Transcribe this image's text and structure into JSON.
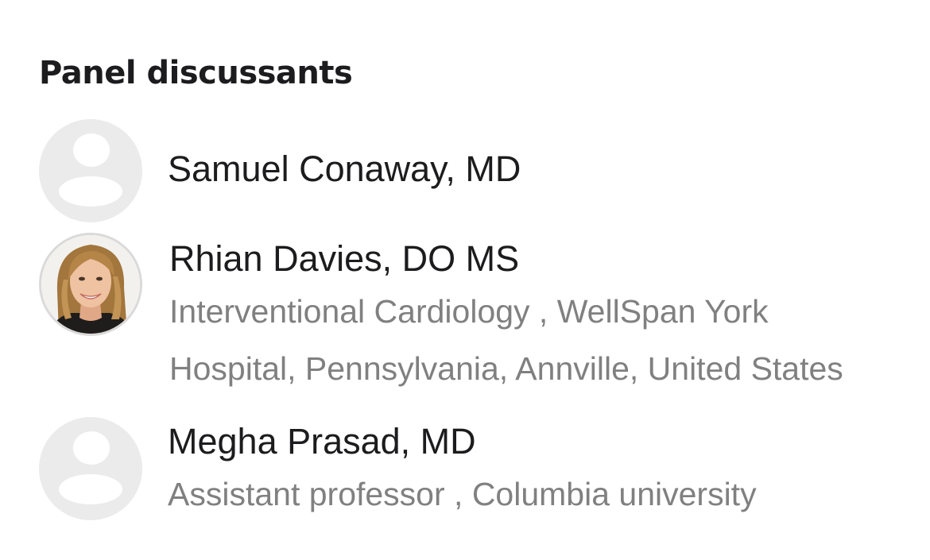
{
  "section": {
    "title": "Panel discussants"
  },
  "panelists": [
    {
      "name": "Samuel Conaway, MD",
      "affiliation": "",
      "avatar": "person-placeholder-icon"
    },
    {
      "name": "Rhian Davies, DO MS",
      "affiliation": "Interventional Cardiology , WellSpan York Hospital, Pennsylvania, Annville, United States",
      "avatar": "profile-photo"
    },
    {
      "name": "Megha Prasad, MD",
      "affiliation": "Assistant professor , Columbia university",
      "avatar": "person-placeholder-icon"
    }
  ],
  "colors": {
    "text_primary": "#1c1c1e",
    "text_secondary": "#808080",
    "placeholder_bg": "#ebebeb",
    "placeholder_glyph": "#ffffff"
  }
}
